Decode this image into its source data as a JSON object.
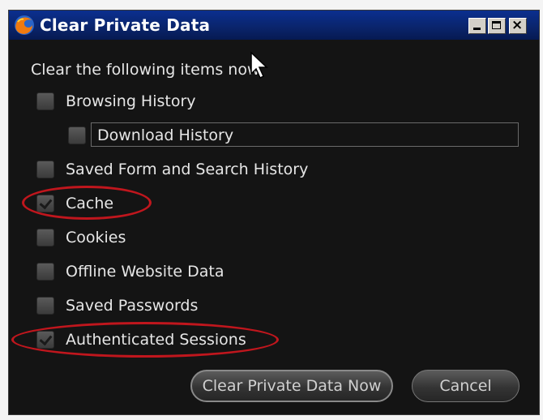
{
  "window": {
    "title": "Clear Private Data",
    "close_glyph": "×",
    "app_icon": "firefox-icon"
  },
  "intro_text": "Clear the following items now",
  "items": [
    {
      "label": "Browsing History",
      "checked": false
    },
    {
      "label": "Download History",
      "checked": false
    },
    {
      "label": "Saved Form and Search History",
      "checked": false
    },
    {
      "label": "Cache",
      "checked": true
    },
    {
      "label": "Cookies",
      "checked": false
    },
    {
      "label": "Offline Website Data",
      "checked": false
    },
    {
      "label": "Saved Passwords",
      "checked": false
    },
    {
      "label": "Authenticated Sessions",
      "checked": true
    }
  ],
  "buttons": {
    "primary": "Clear Private Data Now",
    "cancel": "Cancel"
  },
  "colors": {
    "highlight": "#c0161d",
    "titlebar": "#0a246a",
    "background": "#141414"
  }
}
